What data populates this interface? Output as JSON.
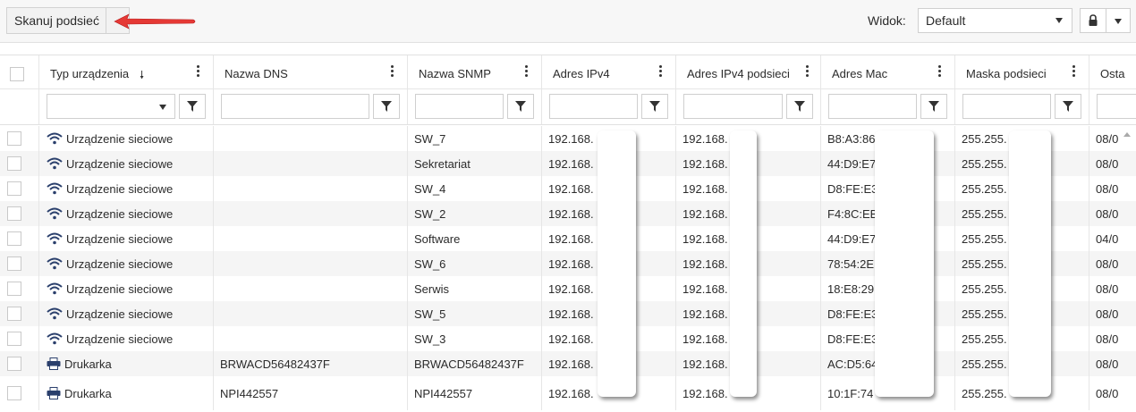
{
  "toolbar": {
    "scan_label": "Skanuj podsieć",
    "view_label": "Widok:",
    "view_value": "Default"
  },
  "columns": [
    {
      "label": "Typ urządzenia"
    },
    {
      "label": "Nazwa DNS"
    },
    {
      "label": "Nazwa SNMP"
    },
    {
      "label": "Adres IPv4"
    },
    {
      "label": "Adres IPv4 podsieci"
    },
    {
      "label": "Adres Mac"
    },
    {
      "label": "Maska podsieci"
    },
    {
      "label": "Osta"
    }
  ],
  "rows": [
    {
      "type": "Urządzenie sieciowe",
      "icon": "wifi-icon",
      "dns": "",
      "snmp": "SW_7",
      "ipv4": "192.168.",
      "subnet": "192.168.",
      "mac": "B8:A3:86",
      "mask": "255.255.",
      "last": "08/0"
    },
    {
      "type": "Urządzenie sieciowe",
      "icon": "wifi-icon",
      "dns": "",
      "snmp": "Sekretariat",
      "ipv4": "192.168.",
      "subnet": "192.168.",
      "mac": "44:D9:E7",
      "mask": "255.255.",
      "last": "08/0"
    },
    {
      "type": "Urządzenie sieciowe",
      "icon": "wifi-icon",
      "dns": "",
      "snmp": "SW_4",
      "ipv4": "192.168.",
      "subnet": "192.168.",
      "mac": "D8:FE:E3",
      "mask": "255.255.",
      "last": "08/0"
    },
    {
      "type": "Urządzenie sieciowe",
      "icon": "wifi-icon",
      "dns": "",
      "snmp": "SW_2",
      "ipv4": "192.168.",
      "subnet": "192.168.",
      "mac": "F4:8C:EB",
      "mask": "255.255.",
      "last": "08/0"
    },
    {
      "type": "Urządzenie sieciowe",
      "icon": "wifi-icon",
      "dns": "",
      "snmp": "Software",
      "ipv4": "192.168.",
      "subnet": "192.168.",
      "mac": "44:D9:E7",
      "mask": "255.255.",
      "last": "04/0"
    },
    {
      "type": "Urządzenie sieciowe",
      "icon": "wifi-icon",
      "dns": "",
      "snmp": "SW_6",
      "ipv4": "192.168.",
      "subnet": "192.168.",
      "mac": "78:54:2E",
      "mask": "255.255.",
      "last": "08/0"
    },
    {
      "type": "Urządzenie sieciowe",
      "icon": "wifi-icon",
      "dns": "",
      "snmp": "Serwis",
      "ipv4": "192.168.",
      "subnet": "192.168.",
      "mac": "18:E8:29",
      "mask": "255.255.",
      "last": "08/0"
    },
    {
      "type": "Urządzenie sieciowe",
      "icon": "wifi-icon",
      "dns": "",
      "snmp": "SW_5",
      "ipv4": "192.168.",
      "subnet": "192.168.",
      "mac": "D8:FE:E3",
      "mask": "255.255.",
      "last": "08/0"
    },
    {
      "type": "Urządzenie sieciowe",
      "icon": "wifi-icon",
      "dns": "",
      "snmp": "SW_3",
      "ipv4": "192.168.",
      "subnet": "192.168.",
      "mac": "D8:FE:E3",
      "mask": "255.255.",
      "last": "08/0"
    },
    {
      "type": "Drukarka",
      "icon": "printer-icon",
      "dns": "BRWACD56482437F",
      "snmp": "BRWACD56482437F",
      "ipv4": "192.168.",
      "subnet": "192.168.",
      "mac": "AC:D5:64",
      "mask": "255.255.",
      "last": "08/0"
    },
    {
      "type": "Drukarka",
      "icon": "printer-icon",
      "dns": "NPI442557",
      "snmp": "NPI442557",
      "ipv4": "192.168.",
      "subnet": "192.168.",
      "mac": "10:1F:74",
      "mask": "255.255.",
      "last": "08/0"
    }
  ],
  "colors": {
    "toolbar_bg": "#f7f7f7",
    "alt_row": "#f5f5f5",
    "arrow": "#e53935",
    "icon_blue": "#2a3f6c"
  }
}
